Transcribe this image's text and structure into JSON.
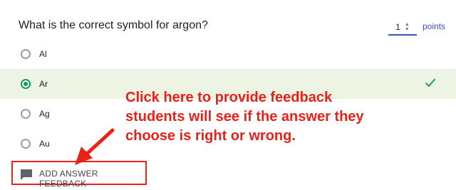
{
  "question": {
    "text": "What is the correct symbol for argon?",
    "points_value": "1",
    "points_label": "points"
  },
  "options": [
    {
      "label": "Al",
      "selected": false,
      "correct": false
    },
    {
      "label": "Ar",
      "selected": true,
      "correct": true
    },
    {
      "label": "Ag",
      "selected": false,
      "correct": false
    },
    {
      "label": "Au",
      "selected": false,
      "correct": false
    }
  ],
  "feedback": {
    "button_label": "ADD ANSWER FEEDBACK"
  },
  "annotation": {
    "text": "Click here to provide feedback\nstudents will see if the answer they\nchoose is right or wrong."
  },
  "colors": {
    "accent": "#3f51b5",
    "correct_green": "#0f9d58",
    "correct_bg": "#edf4e3",
    "annotation_red": "#e8211a"
  }
}
